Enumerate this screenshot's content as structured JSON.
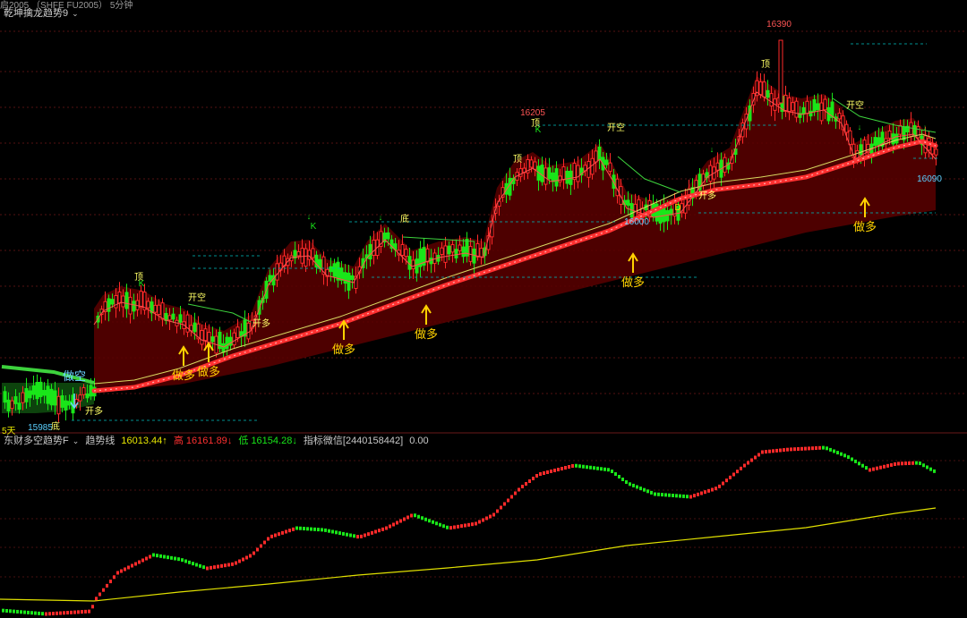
{
  "window": {
    "title_fragment": "启2005 （SHFE FU2005） 5分钟"
  },
  "main_panel": {
    "indicator_name": "乾坤擒龙趋势9",
    "period_label": "5天",
    "price_labels": {
      "high": "16390",
      "mid_high": "16205",
      "mid_low": "16000",
      "right": "16090",
      "low": "15985"
    },
    "colors": {
      "up": "#ff2a2a",
      "down": "#19e619",
      "fill": "#5a0000",
      "trend_line": "#ff3030",
      "ma_yellow": "#d8d860",
      "signal": "#ffd200",
      "grid": "#8b1e1e",
      "level_line": "#00b3b3"
    },
    "signals": [
      {
        "text": "做多",
        "kind": "long"
      },
      {
        "text": "做多",
        "kind": "long"
      },
      {
        "text": "做多",
        "kind": "long"
      },
      {
        "text": "做多",
        "kind": "long"
      },
      {
        "text": "做多",
        "kind": "long"
      },
      {
        "text": "做多",
        "kind": "long"
      },
      {
        "text": "做空",
        "kind": "short"
      }
    ],
    "annotations": [
      "开空",
      "开多",
      "开多",
      "开空",
      "开空",
      "开多",
      "顶",
      "顶",
      "顶",
      "顶",
      "底",
      "底",
      "K",
      "K",
      "K",
      "D"
    ]
  },
  "sub_panel": {
    "indicator_name": "东财多空趋势F",
    "trend_label": "趋势线",
    "trend_value": "16013.44",
    "high_label": "高",
    "high_value": "16161.89",
    "low_label": "低",
    "low_value": "16154.28",
    "wechat_label": "指标微信[2440158442]",
    "wechat_value": "0.00",
    "colors": {
      "value": "#e8e800",
      "high": "#ff3030",
      "low": "#19e619",
      "trend_yellow": "#e0e000"
    }
  }
}
